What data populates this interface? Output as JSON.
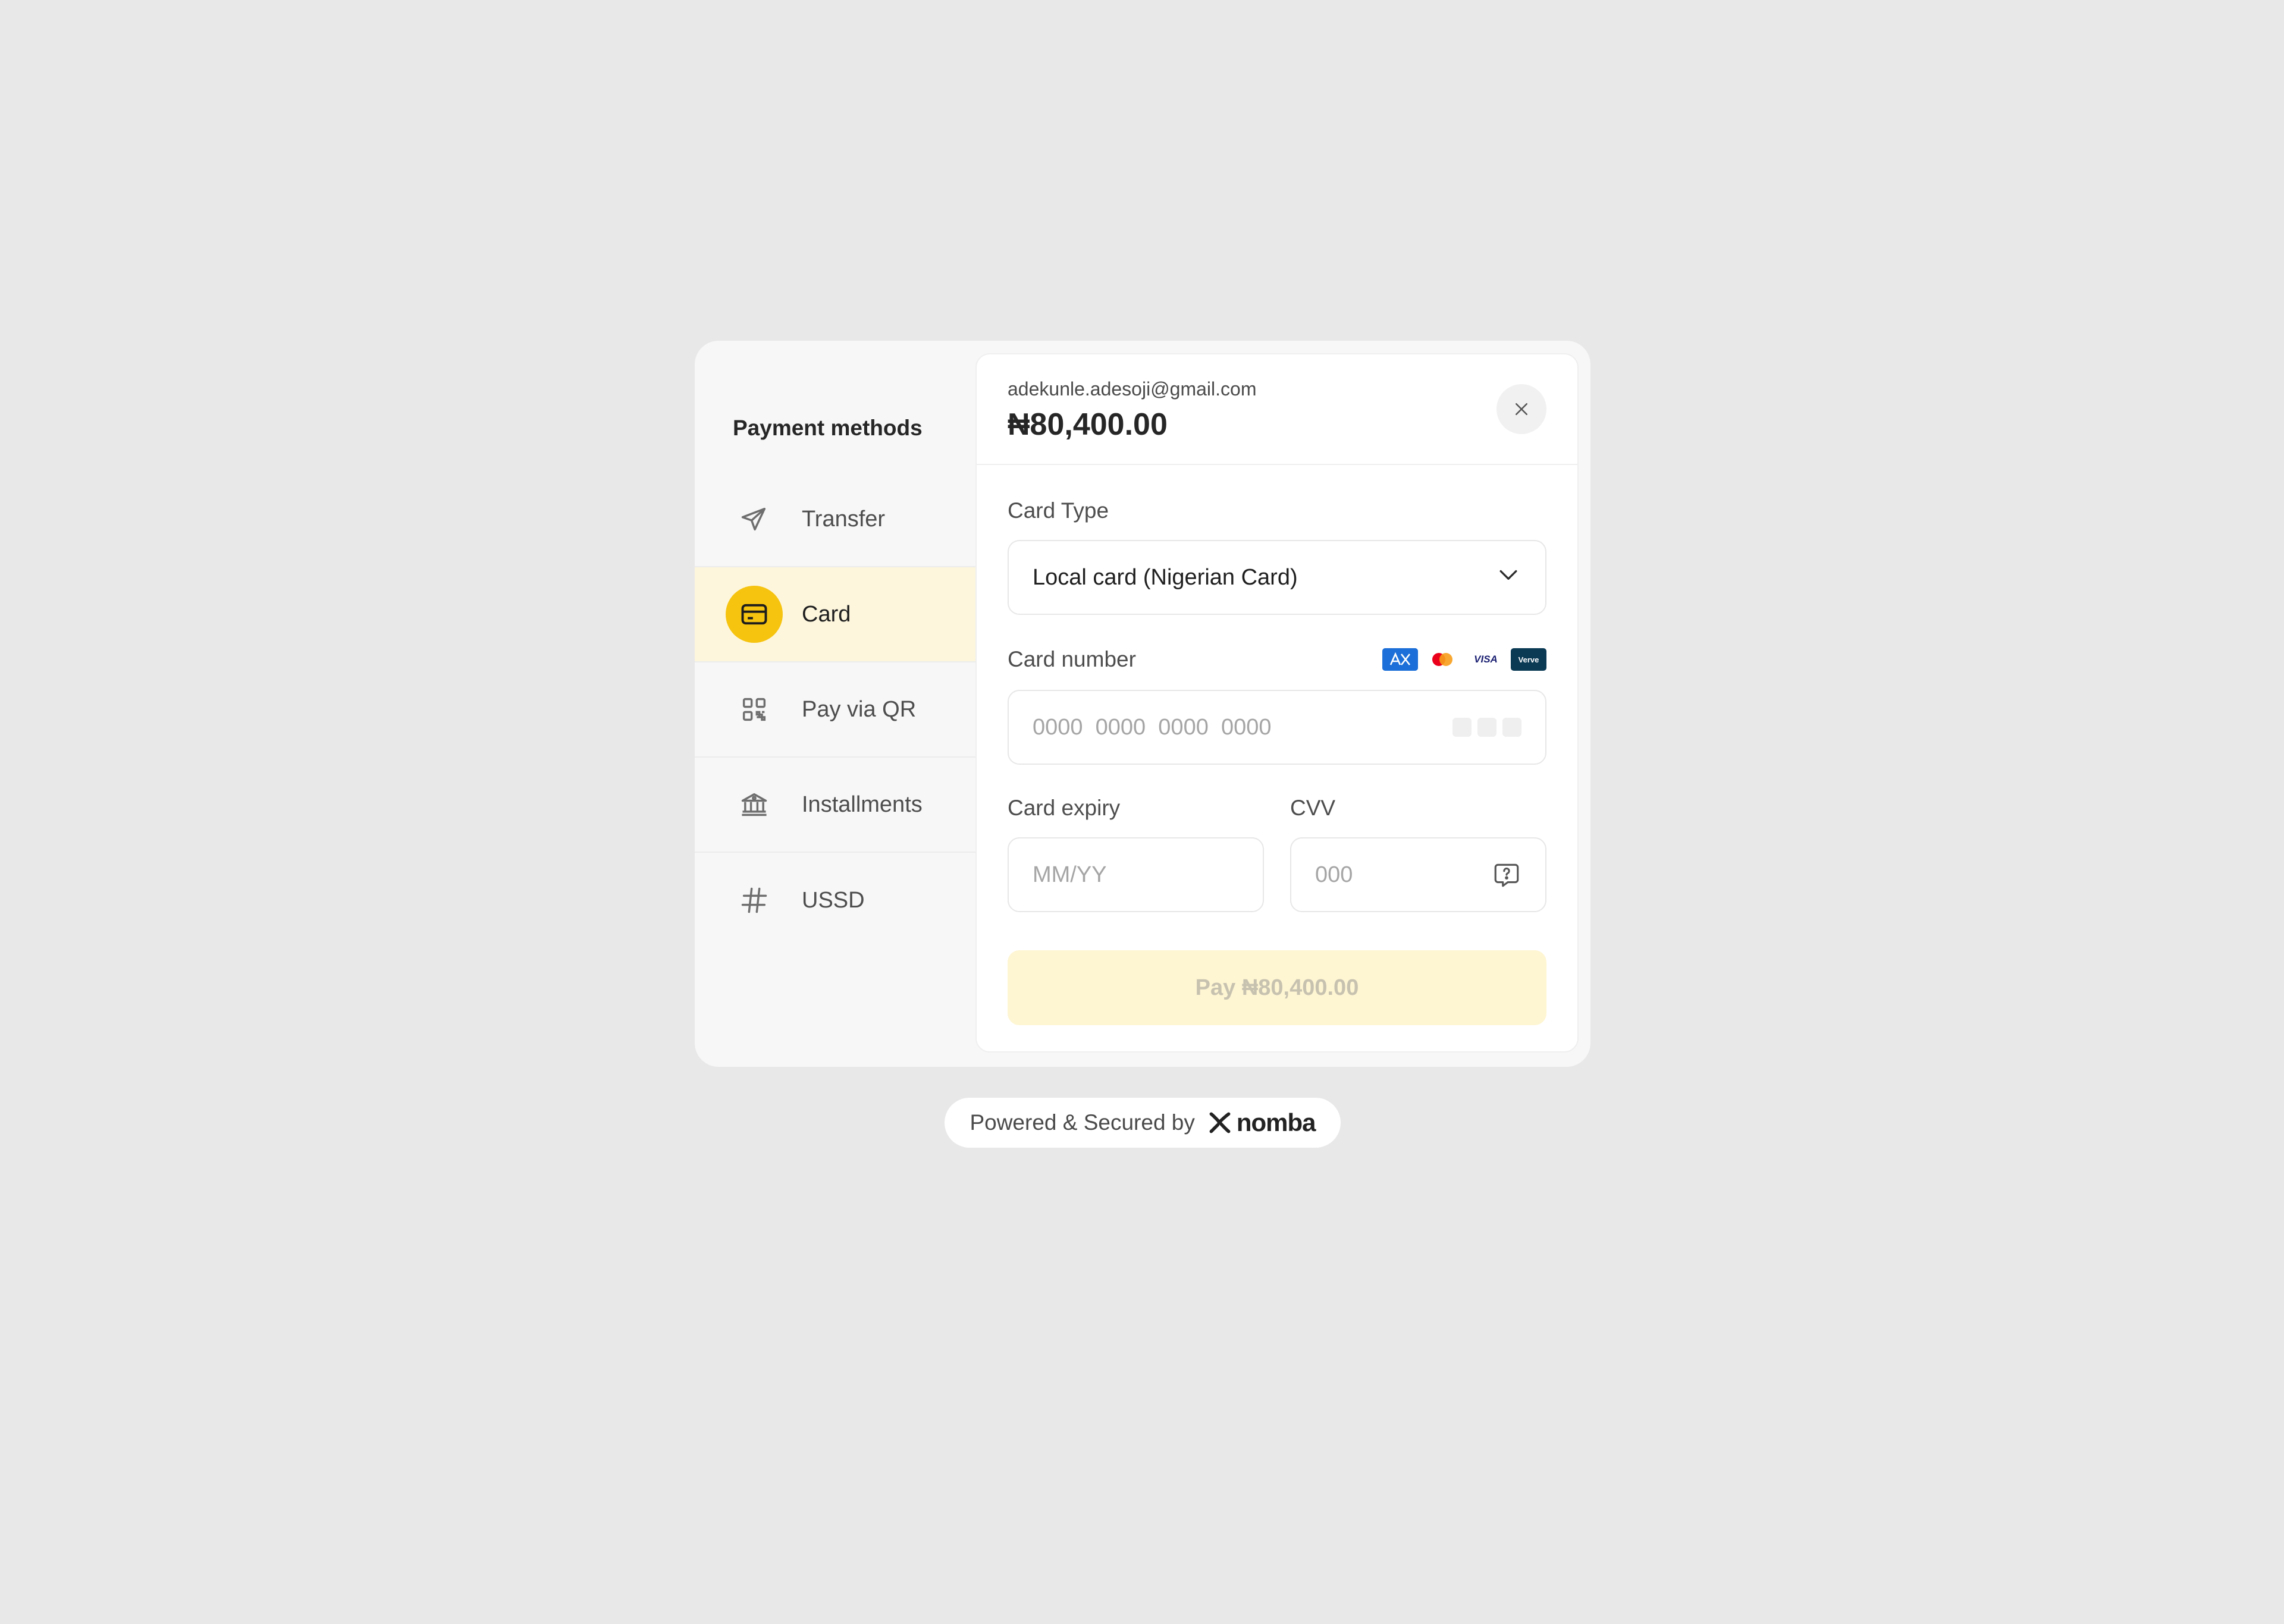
{
  "sidebar": {
    "title": "Payment methods",
    "items": [
      {
        "label": "Transfer",
        "icon": "send-icon",
        "active": false
      },
      {
        "label": "Card",
        "icon": "credit-card-icon",
        "active": true
      },
      {
        "label": "Pay via QR",
        "icon": "qr-code-icon",
        "active": false
      },
      {
        "label": "Installments",
        "icon": "bank-icon",
        "active": false
      },
      {
        "label": "USSD",
        "icon": "hash-icon",
        "active": false
      }
    ]
  },
  "header": {
    "email": "adekunle.adesoji@gmail.com",
    "amount": "₦80,400.00"
  },
  "form": {
    "card_type": {
      "label": "Card Type",
      "value": "Local card (Nigerian Card)"
    },
    "card_number": {
      "label": "Card number",
      "placeholder": "0000  0000  0000  0000",
      "brands": [
        "amex-logo",
        "mastercard-logo",
        "visa-logo",
        "verve-logo"
      ],
      "visa_text": "VISA",
      "verve_text": "Verve"
    },
    "card_expiry": {
      "label": "Card expiry",
      "placeholder": "MM/YY"
    },
    "cvv": {
      "label": "CVV",
      "placeholder": "000"
    },
    "pay_button": "Pay ₦80,400.00"
  },
  "footer": {
    "text": "Powered & Secured by",
    "brand": "nomba"
  },
  "colors": {
    "accent": "#f6c30f",
    "active_bg": "#fdf6dd",
    "pay_button_bg": "#fef5d2",
    "page_bg": "#e8e8e8"
  }
}
